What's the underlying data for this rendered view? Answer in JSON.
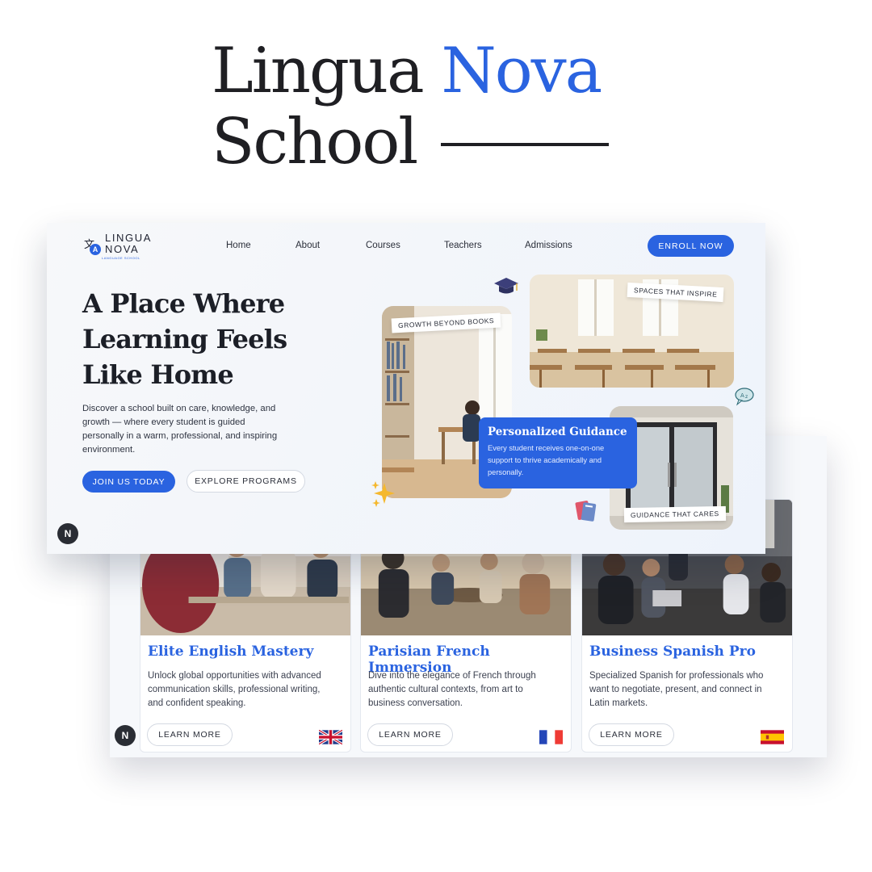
{
  "brand_heading": {
    "line1_prefix": "Lingua",
    "line1_accent": "Nova",
    "line2": "School"
  },
  "colors": {
    "accent": "#2a63e0",
    "dark": "#1c1f27",
    "panel": "#f6f8fb"
  },
  "navbar": {
    "logo": {
      "line1": "LINGUA",
      "line2": "NOVA",
      "tagline": "LANGUAGE SCHOOL"
    },
    "links": [
      "Home",
      "About",
      "Courses",
      "Teachers",
      "Admissions"
    ],
    "enroll_label": "ENROLL NOW"
  },
  "hero": {
    "title": "A Place Where Learning Feels Like Home",
    "description": "Discover a school built on care, knowledge, and growth — where every student is guided personally in a warm, professional, and inspiring environment.",
    "primary_cta": "JOIN US TODAY",
    "secondary_cta": "EXPLORE PROGRAMS",
    "badge": "N",
    "tags": [
      "GROWTH BEYOND BOOKS",
      "SPACES THAT INSPIRE",
      "GUIDANCE THAT CARES"
    ],
    "guidance_card": {
      "title": "Personalized Guidance",
      "text": "Every student receives one-on-one support to thrive academically and personally."
    },
    "icons": [
      "graduation-cap-icon",
      "speech-bubble-icon",
      "sparkles-icon",
      "books-icon"
    ]
  },
  "courses": {
    "badge": "N",
    "items": [
      {
        "title": "Elite English Mastery",
        "description": "Unlock global opportunities with advanced communication skills, professional writing, and confident speaking.",
        "button": "LEARN MORE",
        "flag": "uk-flag-icon"
      },
      {
        "title": "Parisian French Immersion",
        "description": "Dive into the elegance of French through authentic cultural contexts, from art to business conversation.",
        "button": "LEARN MORE",
        "flag": "france-flag-icon"
      },
      {
        "title": "Business Spanish Pro",
        "description": "Specialized Spanish for professionals who want to negotiate, present, and connect in Latin markets.",
        "button": "LEARN MORE",
        "flag": "spain-flag-icon"
      }
    ]
  }
}
